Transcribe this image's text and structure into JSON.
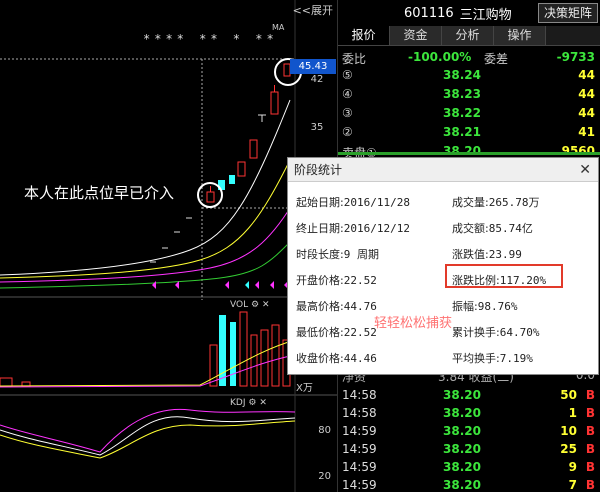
{
  "chart": {
    "expand_label": "<<展开",
    "stars": "**** ** * **",
    "ma_label": "MA",
    "current_price": "45.43",
    "ticks": [
      "42",
      "35"
    ],
    "annotation": "本人在此点位早已介入",
    "vol_label": "VOL",
    "kdj_label": "KDJ",
    "kdj_ticks": [
      "80",
      "20"
    ],
    "unit_label": "X万",
    "colors": {
      "up": "#ff3333",
      "down": "#33ffff",
      "ma_white": "#ffffff",
      "ma_yellow": "#ffff33",
      "ma_pink": "#ff33ff",
      "ma_green": "#33cc33"
    }
  },
  "panel": {
    "code": "601116",
    "name": "三江购物",
    "decision_button": "决策矩阵",
    "tabs": [
      "报价",
      "资金",
      "分析",
      "操作"
    ],
    "committee": {
      "label1": "委比",
      "ratio": "-100.00%",
      "label2": "委差",
      "diff": "-9733"
    },
    "sell_orders": [
      {
        "label": "⑤",
        "price": "38.24",
        "vol": "44"
      },
      {
        "label": "④",
        "price": "38.23",
        "vol": "44"
      },
      {
        "label": "③",
        "price": "38.22",
        "vol": "44"
      },
      {
        "label": "②",
        "price": "38.21",
        "vol": "41"
      },
      {
        "label": "卖盘①",
        "price": "38.20",
        "vol": "9560"
      }
    ],
    "partial_row": {
      "left": "净资",
      "mid": "3.84 收益(二)",
      "right": "0.0"
    },
    "trades": [
      {
        "time": "14:58",
        "price": "38.20",
        "vol": "50",
        "side": "B"
      },
      {
        "time": "14:58",
        "price": "38.20",
        "vol": "1",
        "side": "B"
      },
      {
        "time": "14:59",
        "price": "38.20",
        "vol": "10",
        "side": "B"
      },
      {
        "time": "14:59",
        "price": "38.20",
        "vol": "25",
        "side": "B"
      },
      {
        "time": "14:59",
        "price": "38.20",
        "vol": "9",
        "side": "B"
      },
      {
        "time": "14:59",
        "price": "38.20",
        "vol": "7",
        "side": "B"
      }
    ]
  },
  "popup": {
    "title": "阶段统计",
    "close": "✕",
    "fields": [
      {
        "label": "起始日期:",
        "value": "2016/11/28"
      },
      {
        "label": "成交量:",
        "value": "265.78万"
      },
      {
        "label": "终止日期:",
        "value": "2016/12/12"
      },
      {
        "label": "成交额:",
        "value": "85.74亿"
      },
      {
        "label": "时段长度:",
        "value": "9 周期"
      },
      {
        "label": "涨跌值:",
        "value": "23.99"
      },
      {
        "label": "开盘价格:",
        "value": "22.52"
      },
      {
        "label": "涨跌比例:",
        "value": "117.20%"
      },
      {
        "label": "最高价格:",
        "value": "44.76"
      },
      {
        "label": "振幅:",
        "value": "98.76%"
      },
      {
        "label": "最低价格:",
        "value": "22.52"
      },
      {
        "label": "累计换手:",
        "value": "64.70%"
      },
      {
        "label": "收盘价格:",
        "value": "44.46"
      },
      {
        "label": "平均换手:",
        "value": "7.19%"
      }
    ],
    "watermark": "轻轻松松捕获"
  }
}
